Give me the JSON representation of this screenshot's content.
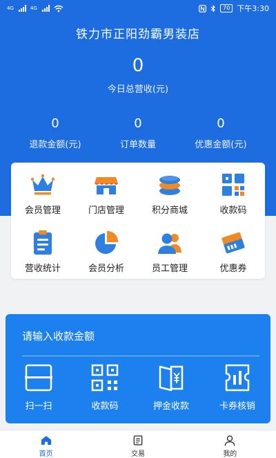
{
  "status_bar": {
    "network_1": "4G",
    "network_2": "4G",
    "battery": "70",
    "time": "下午3:30"
  },
  "header": {
    "store_name": "铁力市正阳劲霸男装店",
    "today_revenue_value": "0",
    "today_revenue_label": "今日总营收(元)",
    "stats": [
      {
        "value": "0",
        "label": "退款金额(元)"
      },
      {
        "value": "0",
        "label": "订单数量"
      },
      {
        "value": "0",
        "label": "优惠金额(元)"
      }
    ]
  },
  "menu": {
    "items": [
      {
        "label": "会员管理",
        "icon": "crown-icon"
      },
      {
        "label": "门店管理",
        "icon": "store-icon"
      },
      {
        "label": "积分商城",
        "icon": "coin-stack-icon"
      },
      {
        "label": "收款码",
        "icon": "qr-grid-icon"
      },
      {
        "label": "营收统计",
        "icon": "clipboard-icon"
      },
      {
        "label": "会员分析",
        "icon": "pie-chart-icon"
      },
      {
        "label": "员工管理",
        "icon": "staff-icon"
      },
      {
        "label": "优惠券",
        "icon": "coupon-icon"
      }
    ]
  },
  "payment": {
    "amount_placeholder": "请输入收款金额",
    "actions": [
      {
        "label": "扫一扫",
        "icon": "scan-icon"
      },
      {
        "label": "收款码",
        "icon": "qr-code-icon"
      },
      {
        "label": "押金收款",
        "icon": "deposit-icon"
      },
      {
        "label": "卡券核销",
        "icon": "ticket-icon"
      }
    ]
  },
  "tabs": [
    {
      "label": "首页",
      "icon": "home-icon",
      "active": true
    },
    {
      "label": "交易",
      "icon": "document-icon",
      "active": false
    },
    {
      "label": "我的",
      "icon": "user-icon",
      "active": false
    }
  ],
  "colors": {
    "header_blue": "#1d6de0",
    "panel_blue": "#1c80ef",
    "accent_orange": "#f08a24",
    "accent_red": "#e8542f"
  }
}
